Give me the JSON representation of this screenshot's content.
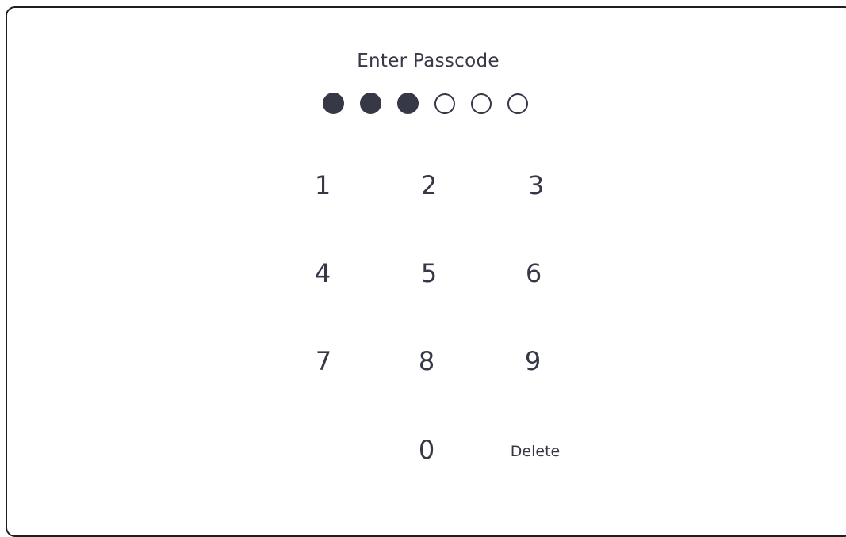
{
  "title": "Enter Passcode",
  "passcode": {
    "length": 6,
    "entered": 3,
    "dot_color": "#363847"
  },
  "keypad": {
    "keys": [
      "1",
      "2",
      "3",
      "4",
      "5",
      "6",
      "7",
      "8",
      "9",
      "0"
    ],
    "delete_label": "Delete"
  }
}
